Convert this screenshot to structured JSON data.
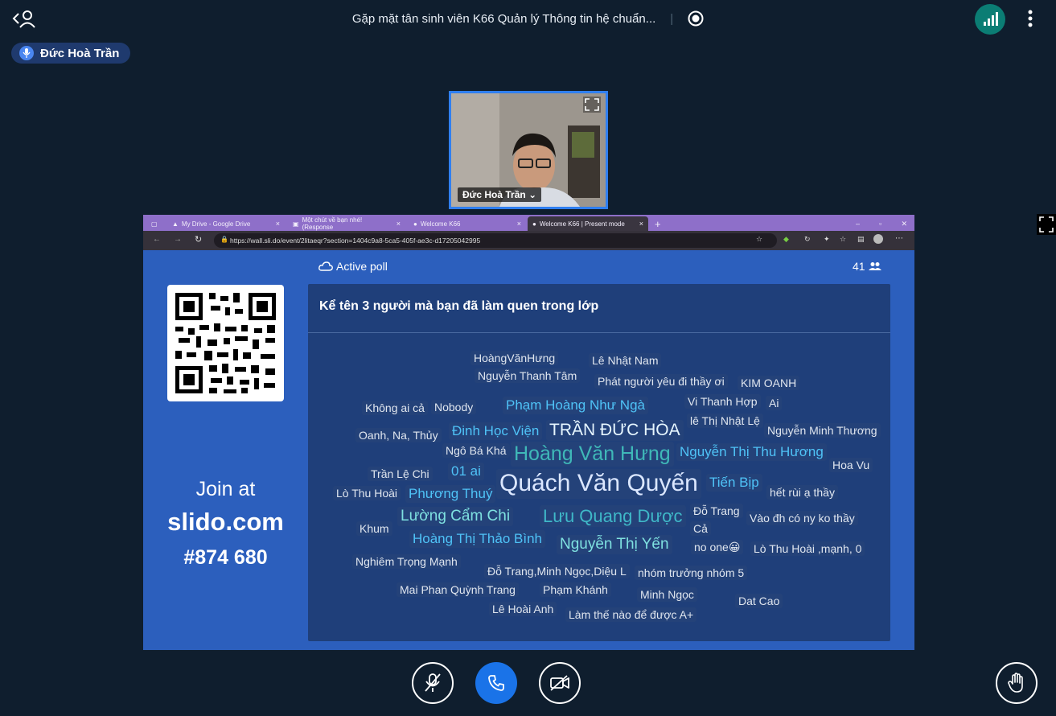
{
  "meeting": {
    "title": "Gặp mặt tân sinh viên K66 Quản lý Thông tin hệ chuẩn...",
    "separator": "|",
    "active_speaker": "Đức Hoà Trần"
  },
  "self_view": {
    "name": "Đức Hoà Trần",
    "chevron": "⌄"
  },
  "browser": {
    "tabs": [
      {
        "label": "My Drive - Google Drive",
        "close": "×"
      },
      {
        "label": "Một chút về bạn nhé! (Response",
        "close": "×"
      },
      {
        "label": "Welcome K66",
        "close": "×"
      },
      {
        "label": "Welcome K66 | Present mode",
        "close": "×"
      }
    ],
    "new_tab": "+",
    "url": "https://wall.sli.do/event/2litaeqr?section=1404c9a8-5ca5-405f-ae3c-d17205042995"
  },
  "slido": {
    "poll_status": "Active poll",
    "participants": "41",
    "join_at": "Join at",
    "site": "slido.com",
    "code": "#874 680",
    "question": "Kể tên 3 người mà bạn đã làm quen trong lớp"
  },
  "words": [
    {
      "t": "HoàngVănHưng"
    },
    {
      "t": "Lê Nhật Nam"
    },
    {
      "t": "Nguyễn Thanh Tâm"
    },
    {
      "t": "Phát người yêu đi thầy ơi"
    },
    {
      "t": "KIM OANH"
    },
    {
      "t": "Không ai cả"
    },
    {
      "t": "Nobody"
    },
    {
      "t": "Phạm Hoàng Như Ngà"
    },
    {
      "t": "Vi Thanh Hợp"
    },
    {
      "t": "Ai"
    },
    {
      "t": "lê Thị Nhật Lệ"
    },
    {
      "t": "Oanh, Na, Thủy"
    },
    {
      "t": "Đinh Học Viện"
    },
    {
      "t": "TRẦN ĐỨC HÒA"
    },
    {
      "t": "Nguyễn Minh Thương"
    },
    {
      "t": "Ngô Bá Khá"
    },
    {
      "t": "Hoàng Văn Hưng"
    },
    {
      "t": "Nguyễn Thị Thu Hương"
    },
    {
      "t": "Trần Lệ Chi"
    },
    {
      "t": "01 ai"
    },
    {
      "t": "Hoa Vu"
    },
    {
      "t": "Quách Văn Quyến"
    },
    {
      "t": "Tiến Bịp"
    },
    {
      "t": "Lò Thu Hoài"
    },
    {
      "t": "Phương Thuý"
    },
    {
      "t": "hết rùi ạ thầy"
    },
    {
      "t": "Lường Cẩm Chi"
    },
    {
      "t": "Lưu Quang Dược"
    },
    {
      "t": "Đỗ Trang"
    },
    {
      "t": "Vào đh có ny ko thầy"
    },
    {
      "t": "Khum"
    },
    {
      "t": "Cả"
    },
    {
      "t": "Hoàng Thị Thảo Bình"
    },
    {
      "t": "Nguyễn Thị Yến"
    },
    {
      "t": "no one😀"
    },
    {
      "t": "Lò Thu Hoài ,mạnh, 0"
    },
    {
      "t": "Nghiêm Trọng Mạnh"
    },
    {
      "t": "Đỗ Trang,Minh Ngọc,Diệu L"
    },
    {
      "t": "nhóm trưởng nhóm 5"
    },
    {
      "t": "Mai Phan Quỳnh Trang"
    },
    {
      "t": "Phạm Khánh"
    },
    {
      "t": "Minh Ngọc"
    },
    {
      "t": "Dat Cao"
    },
    {
      "t": "Lê Hoài Anh"
    },
    {
      "t": "Làm thế nào để được A+"
    }
  ],
  "colors": {
    "accent": "#1a73e8",
    "teal": "#0b7d74",
    "word_highlight": "#4fc3f7",
    "word_strong": "#7ee0e0"
  }
}
